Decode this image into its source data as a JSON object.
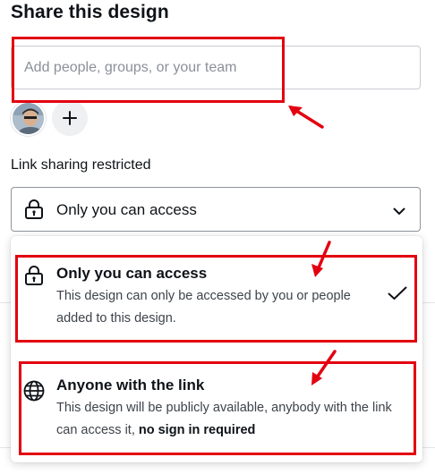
{
  "header": {
    "title": "Share this design"
  },
  "people_input": {
    "placeholder": "Add people, groups, or your team"
  },
  "link_sharing": {
    "label": "Link sharing restricted",
    "selected_value": "Only you can access"
  },
  "dropdown": {
    "options": [
      {
        "title": "Only you can access",
        "description": "This design can only be accessed by you or people added to this design.",
        "selected": true,
        "icon": "lock-icon"
      },
      {
        "title": "Anyone with the link",
        "description_part1": "This design will be publicly available, anybody with the link can access it,",
        "description_bold": "no sign in required",
        "selected": false,
        "icon": "globe-icon"
      }
    ]
  },
  "annotation_color": "#e3000f",
  "icons": [
    "add-person-icon",
    "lock-icon",
    "chevron-down-icon",
    "checkmark-icon",
    "globe-icon"
  ]
}
